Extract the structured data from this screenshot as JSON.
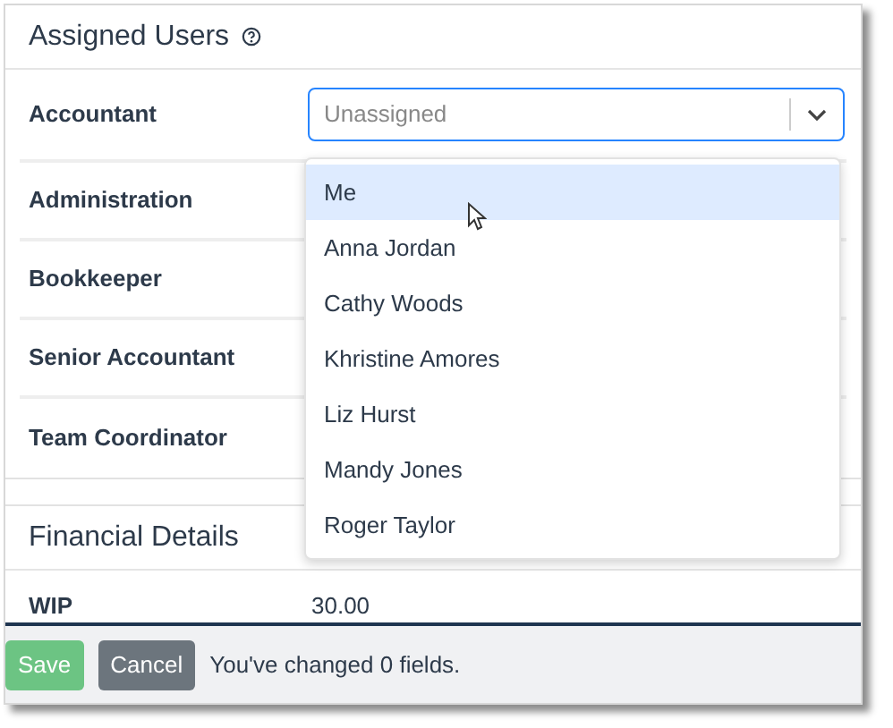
{
  "assigned_users": {
    "title": "Assigned Users",
    "rows": [
      {
        "label": "Accountant",
        "select": {
          "placeholder": "Unassigned",
          "open": true
        }
      },
      {
        "label": "Administration"
      },
      {
        "label": "Bookkeeper"
      },
      {
        "label": "Senior Accountant"
      },
      {
        "label": "Team Coordinator"
      }
    ],
    "dropdown_options": [
      {
        "label": "Me",
        "selected": true
      },
      {
        "label": "Anna Jordan",
        "selected": false
      },
      {
        "label": "Cathy Woods",
        "selected": false
      },
      {
        "label": "Khristine Amores",
        "selected": false
      },
      {
        "label": "Liz Hurst",
        "selected": false
      },
      {
        "label": "Mandy Jones",
        "selected": false
      },
      {
        "label": "Roger Taylor",
        "selected": false
      }
    ]
  },
  "financial_details": {
    "title": "Financial Details",
    "rows": [
      {
        "label": "WIP",
        "value": "30.00"
      }
    ]
  },
  "footer": {
    "save": "Save",
    "cancel": "Cancel",
    "status": "You've changed 0 fields."
  }
}
